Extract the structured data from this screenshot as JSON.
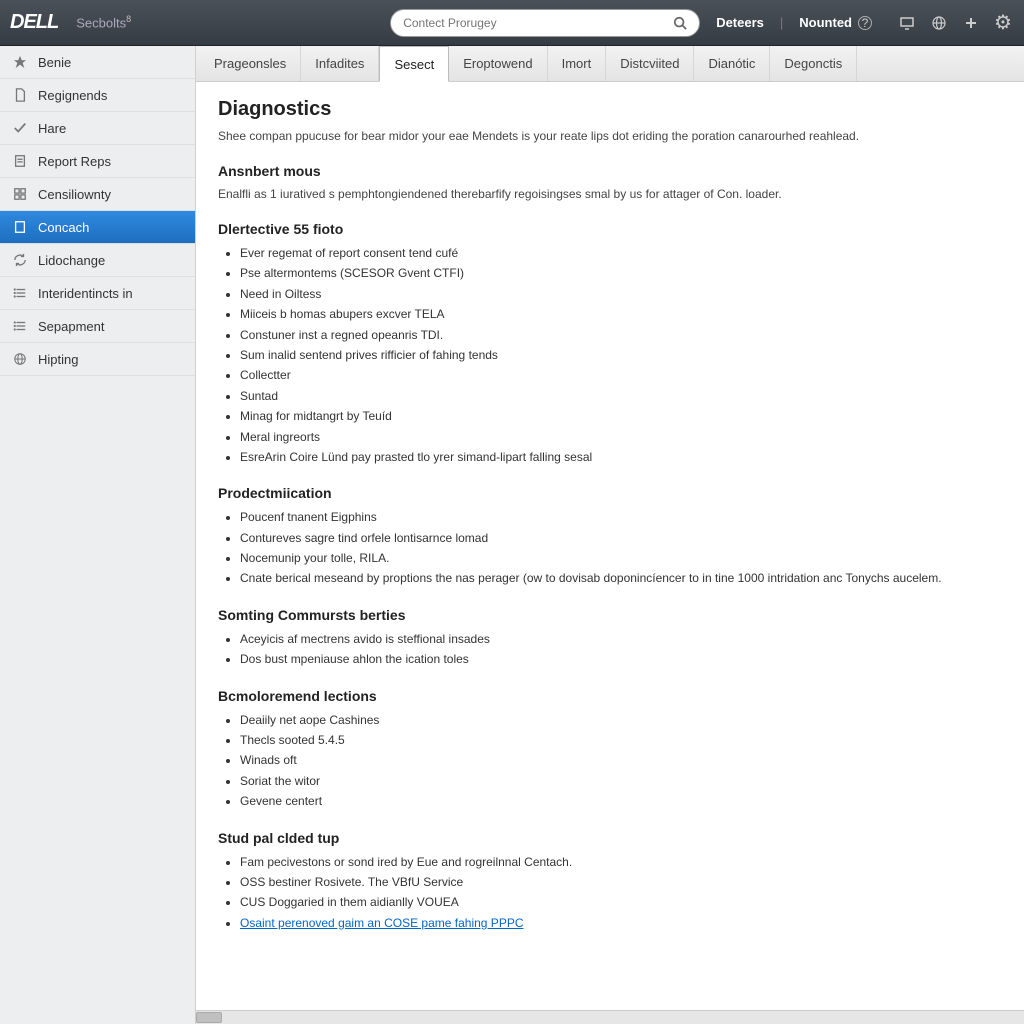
{
  "header": {
    "logo": "DELL",
    "category": "Secbolts",
    "category_sup": "8",
    "search_placeholder": "Contect Prorugey",
    "link_detect": "Deteers",
    "link_nounted": "Nounted"
  },
  "sidebar": {
    "items": [
      {
        "label": "Benie",
        "icon": "star"
      },
      {
        "label": "Regignends",
        "icon": "file"
      },
      {
        "label": "Hare",
        "icon": "check"
      },
      {
        "label": "Report Reps",
        "icon": "report"
      },
      {
        "label": "Censiliownty",
        "icon": "grid"
      },
      {
        "label": "Concach",
        "icon": "doc",
        "active": true
      },
      {
        "label": "Lidochange",
        "icon": "refresh"
      },
      {
        "label": "Interidentincts in",
        "icon": "list"
      },
      {
        "label": "Sepapment",
        "icon": "list"
      },
      {
        "label": "Hipting",
        "icon": "globe"
      }
    ]
  },
  "tabs": [
    {
      "label": "Prageonsles"
    },
    {
      "label": "Infadites"
    },
    {
      "label": "Sesect",
      "active": true
    },
    {
      "label": "Eroptowend"
    },
    {
      "label": "Imort"
    },
    {
      "label": "Distcviited"
    },
    {
      "label": "Dianótic"
    },
    {
      "label": "Degonctis"
    }
  ],
  "page": {
    "heading": "Diagnostics",
    "intro": "Shee compan ppucuse for bear midor your eae Mendets is your reate lips dot eriding the poration canarourhed reahlead.",
    "sections": [
      {
        "title": "Ansnbert mous",
        "sub": "Enalfli as 1 iuratived s pemphtongiendened therebarfify regoisingses smal by us for attager of Con. loader.",
        "items": []
      },
      {
        "title": "Dlertective 55 fioto",
        "items": [
          "Ever regemat of report consent tend cufé",
          "Pse altermontems (SCESOR Gvent CTFI)",
          "Need in Oiltess",
          "Miiceis b homas abupers excver TELA",
          "Constuner inst a regned opeanris TDI.",
          "Sum inalid sentend prives rifficier of fahing tends",
          "Collectter",
          "Suntad",
          "Minag for midtangrt by Teuíd",
          "Meral ingreorts",
          "EsreArin Coire Lünd pay prasted tlo yrer simand-lipart falling sesal"
        ]
      },
      {
        "title": "Prodectmiication",
        "items": [
          "Poucenf tnanent Eigphins",
          "Contureves sagre tind orfele lontisarnce lomad",
          "Nocemunip your tolle, RILA.",
          "Cnate berical meseand by proptions the nas perager (ow to dovisab doponincíencer to in tine 1000 intridation anc Tonychs aucelem."
        ]
      },
      {
        "title": "Somting Commursts berties",
        "items": [
          "Aceyicis af mectrens avido is steffional insades",
          "Dos bust mpeniause ahlon the ication toles"
        ]
      },
      {
        "title": "Bcmoloremend lections",
        "items": [
          "Deaiily net aope Cashines",
          "Thecls sooted 5.4.5",
          "Winads oft",
          "Soriat the witor",
          "Gevene centert"
        ]
      },
      {
        "title": "Stud pal clded tup",
        "items": [
          "Fam pecivestons or sond ired by Eue and rogreilnnal Centach.",
          "OSS bestiner Rosivete. The VBfU Service",
          "CUS Doggaried in them aidianlly VOUEA"
        ],
        "link_item": "Osaint perenoved gaim an COSE pame fahing PPPC"
      }
    ]
  }
}
